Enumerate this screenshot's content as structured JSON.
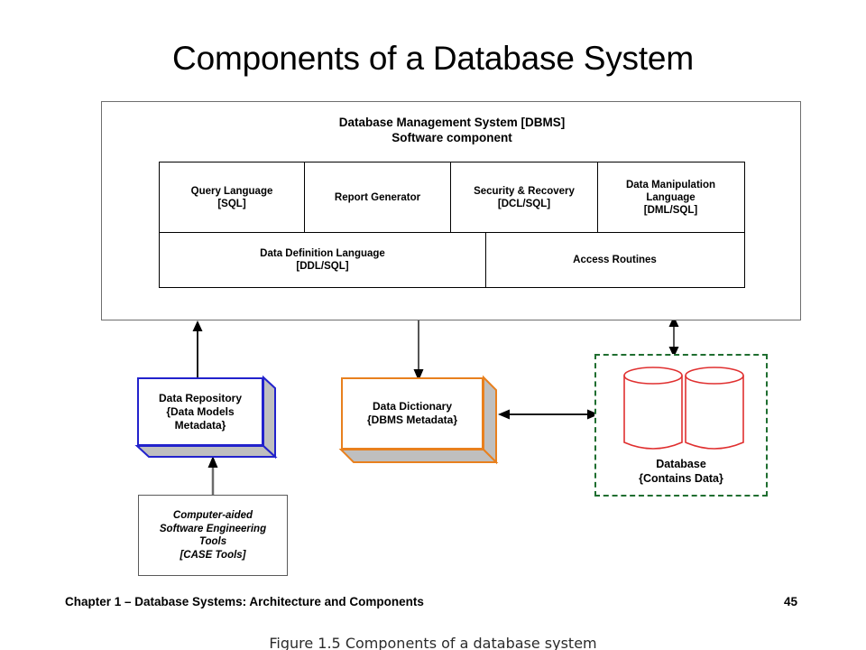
{
  "slide": {
    "title": "Components of a Database System"
  },
  "dbms": {
    "heading_line1": "Database Management System [DBMS]",
    "heading_line2": "Software component",
    "components_row1": [
      {
        "name": "query-language",
        "line1": "Query Language",
        "line2": "[SQL]"
      },
      {
        "name": "report-generator",
        "line1": "Report Generator",
        "line2": ""
      },
      {
        "name": "security-recovery",
        "line1": "Security & Recovery",
        "line2": "[DCL/SQL]"
      },
      {
        "name": "data-manipulation-language",
        "line1": "Data Manipulation",
        "line2": "Language",
        "line3": "[DML/SQL]"
      }
    ],
    "components_row2": [
      {
        "name": "data-definition-language",
        "line1": "Data Definition Language",
        "line2": "[DDL/SQL]"
      },
      {
        "name": "access-routines",
        "line1": "Access Routines",
        "line2": ""
      }
    ]
  },
  "data_repository": {
    "line1": "Data Repository",
    "line2": "{Data Models",
    "line3": "Metadata}"
  },
  "data_dictionary": {
    "line1": "Data Dictionary",
    "line2": "{DBMS Metadata}"
  },
  "case_tools": {
    "line1": "Computer-aided",
    "line2": "Software Engineering",
    "line3": "Tools",
    "line4": "[CASE Tools]"
  },
  "database": {
    "line1": "Database",
    "line2": "{Contains Data}"
  },
  "connectors": [
    {
      "name": "repository-to-dbms",
      "direction": "up",
      "from": "data-repository",
      "to": "dbms"
    },
    {
      "name": "dbms-to-dictionary",
      "direction": "down",
      "from": "dbms",
      "to": "data-dictionary"
    },
    {
      "name": "dbms-to-database",
      "direction": "bidirectional",
      "from": "dbms",
      "to": "database"
    },
    {
      "name": "dictionary-to-database",
      "direction": "bidirectional",
      "from": "data-dictionary",
      "to": "database"
    },
    {
      "name": "case-tools-to-repository",
      "direction": "up",
      "from": "case-tools",
      "to": "data-repository"
    }
  ],
  "footer": {
    "chapter": "Chapter 1 – Database Systems:  Architecture and Components",
    "page_number": "45"
  },
  "figure_caption": "Figure 1.5  Components of a database  system",
  "colors": {
    "repository_border": "#2222cc",
    "dictionary_border": "#e8801e",
    "database_border": "#1f6e30",
    "cylinder_stroke": "#e03030",
    "box_shadow_face": "#bfbfbf",
    "dbms_outline": "#6e6e6e",
    "grid_outline": "#000000",
    "arrow": "#555555"
  }
}
